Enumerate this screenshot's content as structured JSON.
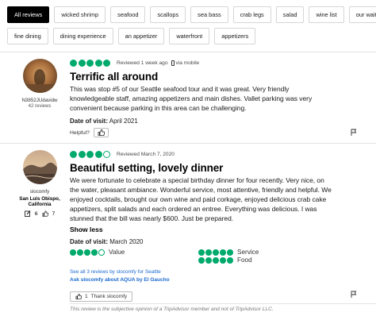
{
  "filters": {
    "row1": [
      "All reviews",
      "wicked shrimp",
      "seafood",
      "scallops",
      "sea bass",
      "crab legs",
      "salad",
      "wine list",
      "our waiter"
    ],
    "row2": [
      "fine dining",
      "dining experience",
      "an appetizer",
      "waterfront",
      "appetizers"
    ]
  },
  "review1": {
    "user": {
      "name": "N3852JUdavidw",
      "reviews": "42 reviews"
    },
    "rating": 5,
    "reviewed": "Reviewed 1 week ago",
    "via": "via mobile",
    "title": "Terrific all around",
    "lines": [
      "This was stop #5 of our Seattle seafood tour and it was great. Very friendly",
      "knowledgeable staff, amazing appetizers and main dishes. Vallet parking was very",
      "convenient because parking in this area can be challenging."
    ],
    "date_label": "Date of visit:",
    "date_value": "April 2021",
    "helpful": "Helpful?"
  },
  "review2": {
    "user": {
      "name": "slocomfy",
      "location_line1": "San Luis Obispo,",
      "location_line2": "California",
      "contributions": "6",
      "helpful_votes": "7"
    },
    "rating": 4,
    "reviewed": "Reviewed March 7, 2020",
    "title": "Beautiful setting, lovely dinner",
    "lines": [
      "We were fortunate to celebrate a special birthday dinner for four recently. Very nice, on",
      "the water, pleasant ambiance. Wonderful service, most attentive, friendly and helpful. We",
      "enjoyed cocktails, brought our own wine and paid corkage, enjoyed delicious crab cake",
      "appetizers, split salads and each ordered an entree. Everything was delicious. I was",
      "stunned that the bill was nearly $600. Just be prepared."
    ],
    "show_less": "Show less",
    "date_label": "Date of visit:",
    "date_value": "March 2020",
    "subratings": [
      {
        "label": "Value",
        "rating": 4
      },
      {
        "label": "Service",
        "rating": 5
      },
      {
        "label": "Food",
        "rating": 5
      }
    ],
    "see_all": "See all 3 reviews by slocomfy for Seattle",
    "ask": "Ask slocomfy about AQUA by El Gaucho",
    "thank_count": "1",
    "thank_label": "Thank slocomfy"
  },
  "disclaimer": "This review is the subjective opinion of a TripAdvisor member and not of TripAdvisor LLC.",
  "colors": {
    "bubble": "#00aa6c",
    "link": "#1c6ad0",
    "active_chip": "#000000"
  }
}
